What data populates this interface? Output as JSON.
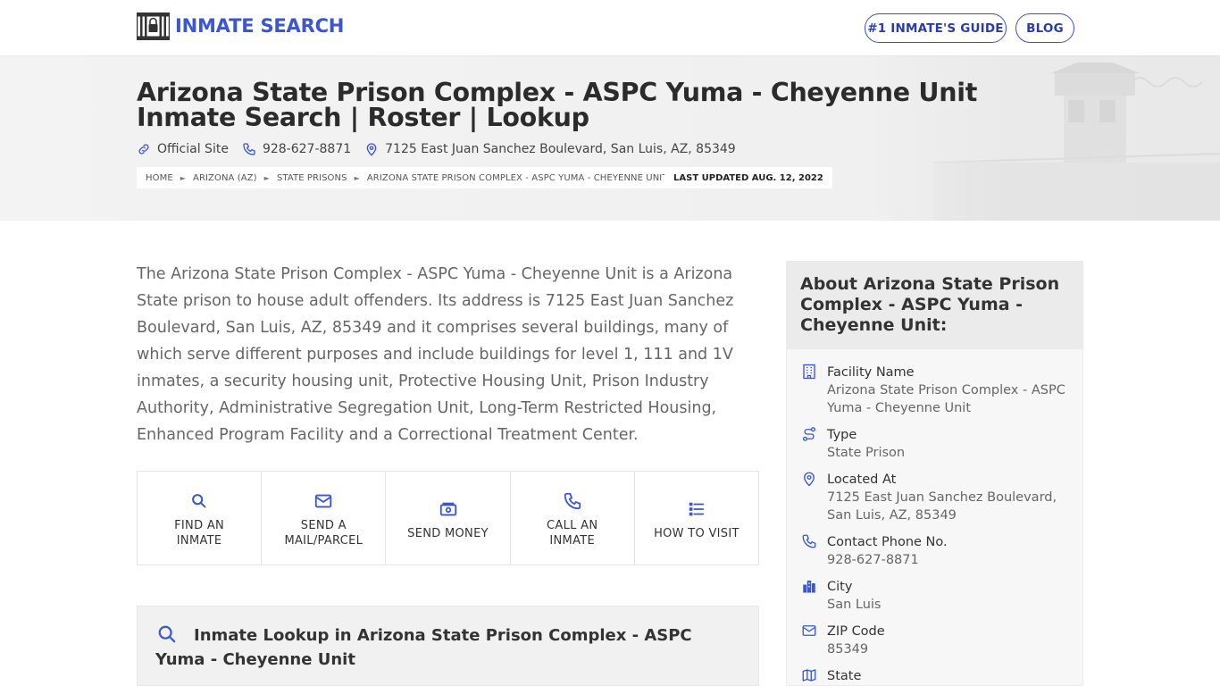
{
  "header": {
    "logo_text": "INMATE SEARCH",
    "nav": {
      "guide_label": "#1 INMATE'S GUIDE",
      "blog_label": "BLOG"
    }
  },
  "hero": {
    "title": "Arizona State Prison Complex - ASPC Yuma - Cheyenne Unit Inmate Search | Roster | Lookup",
    "official_site": "Official Site",
    "phone": "928-627-8871",
    "address": "7125 East Juan Sanchez Boulevard, San Luis, AZ, 85349",
    "breadcrumbs": [
      "HOME",
      "ARIZONA (AZ)",
      "STATE PRISONS",
      "ARIZONA STATE PRISON COMPLEX - ASPC YUMA - CHEYENNE UNIT"
    ],
    "last_updated": "LAST UPDATED AUG. 12, 2022"
  },
  "main": {
    "intro": "The Arizona State Prison Complex - ASPC Yuma - Cheyenne Unit is a Arizona State prison to house adult offenders. Its address is 7125 East Juan Sanchez Boulevard, San Luis, AZ, 85349 and it comprises several buildings, many of which serve different purposes and include buildings for level 1, 111 and 1V inmates, a security housing unit, Protective Housing Unit, Prison Industry Authority, Administrative Segregation Unit, Long-Term Restricted Housing, Enhanced Program Facility and a Correctional Treatment Center.",
    "actions": [
      {
        "label": "FIND AN INMATE",
        "icon": "search-icon"
      },
      {
        "label": "SEND A MAIL/PARCEL",
        "icon": "mail-icon"
      },
      {
        "label": "SEND MONEY",
        "icon": "money-icon"
      },
      {
        "label": "CALL AN INMATE",
        "icon": "phone-icon"
      },
      {
        "label": "HOW TO VISIT",
        "icon": "list-icon"
      }
    ],
    "lookup_title": "Inmate Lookup in Arizona State Prison Complex - ASPC Yuma - Cheyenne Unit"
  },
  "sidebar": {
    "title": "About Arizona State Prison Complex - ASPC Yuma - Cheyenne Unit:",
    "rows": [
      {
        "label": "Facility Name",
        "value": "Arizona State Prison Complex - ASPC Yuma - Cheyenne Unit",
        "icon": "building-icon"
      },
      {
        "label": "Type",
        "value": "State Prison",
        "icon": "route-icon"
      },
      {
        "label": "Located At",
        "value": "7125 East Juan Sanchez Boulevard, San Luis, AZ, 85349",
        "icon": "map-pin-icon"
      },
      {
        "label": "Contact Phone No.",
        "value": "928-627-8871",
        "icon": "phone-icon"
      },
      {
        "label": "City",
        "value": "San Luis",
        "icon": "city-icon"
      },
      {
        "label": "ZIP Code",
        "value": "85349",
        "icon": "mail-icon"
      },
      {
        "label": "State",
        "value": "",
        "icon": "map-icon"
      }
    ]
  },
  "colors": {
    "accent": "#3a56d4",
    "hero_bg": "#f1f1f1",
    "sidebar_head_bg": "#ebebeb"
  }
}
